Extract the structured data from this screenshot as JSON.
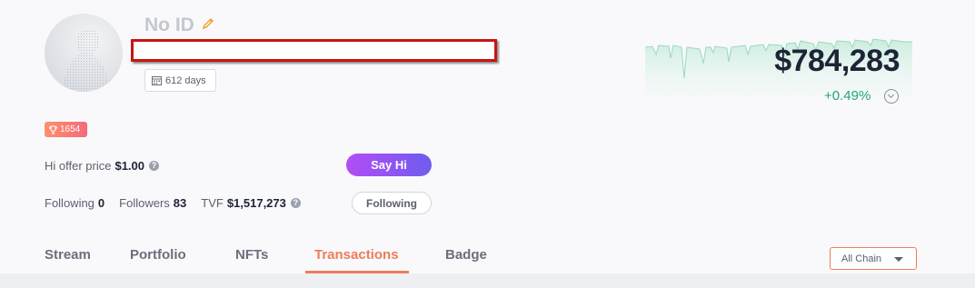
{
  "profile": {
    "name": "No ID",
    "days": "612 days",
    "score": "1654"
  },
  "net_worth": {
    "value": "$784,283",
    "change": "+0.49%"
  },
  "hi_offer": {
    "label": "Hi offer price",
    "value": "$1.00",
    "button": "Say Hi"
  },
  "stats": {
    "following_label": "Following",
    "following_value": "0",
    "followers_label": "Followers",
    "followers_value": "83",
    "tvf_label": "TVF",
    "tvf_value": "$1,517,273",
    "follow_button": "Following"
  },
  "tabs": [
    {
      "label": "Stream"
    },
    {
      "label": "Portfolio"
    },
    {
      "label": "NFTs"
    },
    {
      "label": "Transactions",
      "active": true
    },
    {
      "label": "Badge"
    }
  ],
  "chain_filter": {
    "selected": "All Chain"
  },
  "colors": {
    "accent": "#ef7d58",
    "positive": "#1fa77a",
    "say_hi_start": "#b24df5",
    "say_hi_end": "#6f5cf0"
  }
}
